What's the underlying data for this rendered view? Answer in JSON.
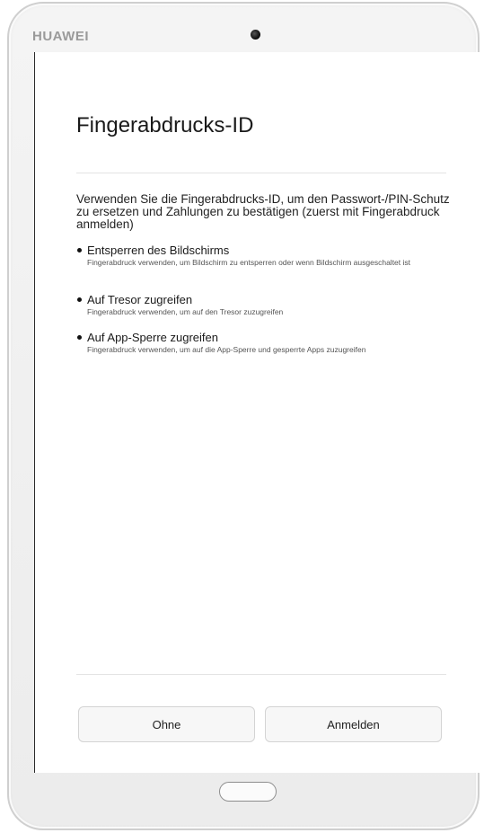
{
  "device": {
    "brand": "HUAWEI"
  },
  "page": {
    "title": "Fingerabdrucks-ID",
    "intro": "Verwenden Sie die Fingerabdrucks-ID, um den Passwort-/PIN-Schutz zu ersetzen und Zahlungen zu bestätigen (zuerst mit Fingerabdruck anmelden)"
  },
  "features": [
    {
      "title": "Entsperren des Bildschirms",
      "description": "Fingerabdruck verwenden, um Bildschirm zu entsperren oder wenn Bildschirm ausgeschaltet ist"
    },
    {
      "title": "Auf Tresor zugreifen",
      "description": "Fingerabdruck verwenden, um auf den Tresor zuzugreifen"
    },
    {
      "title": "Auf App-Sperre zugreifen",
      "description": "Fingerabdruck verwenden, um auf die App-Sperre und gesperrte Apps zuzugreifen"
    }
  ],
  "buttons": {
    "skip_label": "Ohne",
    "register_label": "Anmelden"
  },
  "colors": {
    "brand_gray": "#9a9a9a",
    "button_bg": "#f7f7f7",
    "text": "#1a1a1a"
  },
  "icons": {
    "camera": "front-camera-icon",
    "home": "home-button"
  }
}
